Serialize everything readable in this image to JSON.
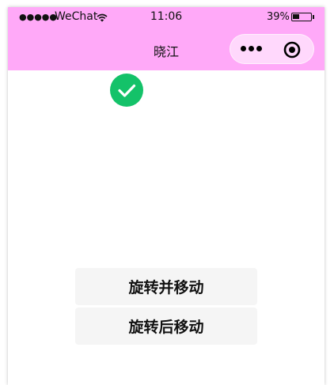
{
  "status_bar": {
    "signal": "●●●●●",
    "carrier": "WeChat",
    "time": "11:06",
    "battery_percent_text": "39%",
    "battery_level": 0.39,
    "background_color": "#ffa9f8"
  },
  "nav_bar": {
    "title": "晓江",
    "more_icon": "more-dots-icon",
    "close_icon": "target-close-icon",
    "background_color": "#ffa9f8"
  },
  "content": {
    "status_icon": "success-check-icon",
    "status_icon_color": "#14c269",
    "buttons": [
      {
        "label": "旋转并移动"
      },
      {
        "label": "旋转后移动"
      }
    ]
  }
}
